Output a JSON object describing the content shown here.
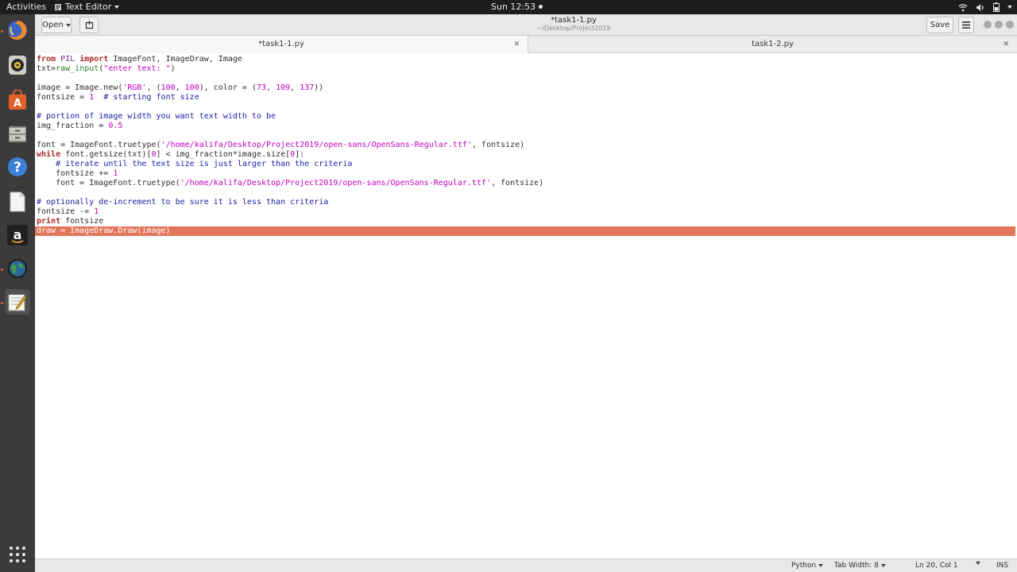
{
  "topbar": {
    "activities": "Activities",
    "app_menu": "Text Editor",
    "clock": "Sun 12:53"
  },
  "dock": {
    "apps": [
      "firefox-icon",
      "rhythmbox-icon",
      "software-center-icon",
      "files-icon",
      "help-icon",
      "document-icon",
      "amazon-icon",
      "globe-icon",
      "text-editor-icon",
      "show-apps-icon"
    ]
  },
  "header": {
    "open_label": "Open",
    "title": "*task1-1.py",
    "subtitle": "~/Desktop/Project2019",
    "save_label": "Save"
  },
  "tabs": [
    {
      "label": "*task1-1.py",
      "active": true
    },
    {
      "label": "task1-2.py",
      "active": false
    }
  ],
  "editor": {
    "lines": [
      "from PIL import ImageFont, ImageDraw, Image",
      "txt=raw_input(\"enter text: \")",
      "",
      "image = Image.new('RGB', (100, 100), color = (73, 109, 137))",
      "fontsize = 1  # starting font size",
      "",
      "# portion of image width you want text width to be",
      "img_fraction = 0.5",
      "",
      "font = ImageFont.truetype('/home/kalifa/Desktop/Project2019/open-sans/OpenSans-Regular.ttf', fontsize)",
      "while font.getsize(txt)[0] < img_fraction*image.size[0]:",
      "    # iterate until the text size is just larger than the criteria",
      "    fontsize += 1",
      "    font = ImageFont.truetype('/home/kalifa/Desktop/Project2019/open-sans/OpenSans-Regular.ttf', fontsize)",
      "",
      "# optionally de-increment to be sure it is less than criteria",
      "fontsize -= 1",
      "print fontsize",
      "draw = ImageDraw.Draw(image)"
    ],
    "highlighted_line_index": 18,
    "selection_color": "#e2765a"
  },
  "statusbar": {
    "language": "Python",
    "tab_width": "Tab Width: 8",
    "position": "Ln 20, Col 1",
    "mode": "INS"
  }
}
